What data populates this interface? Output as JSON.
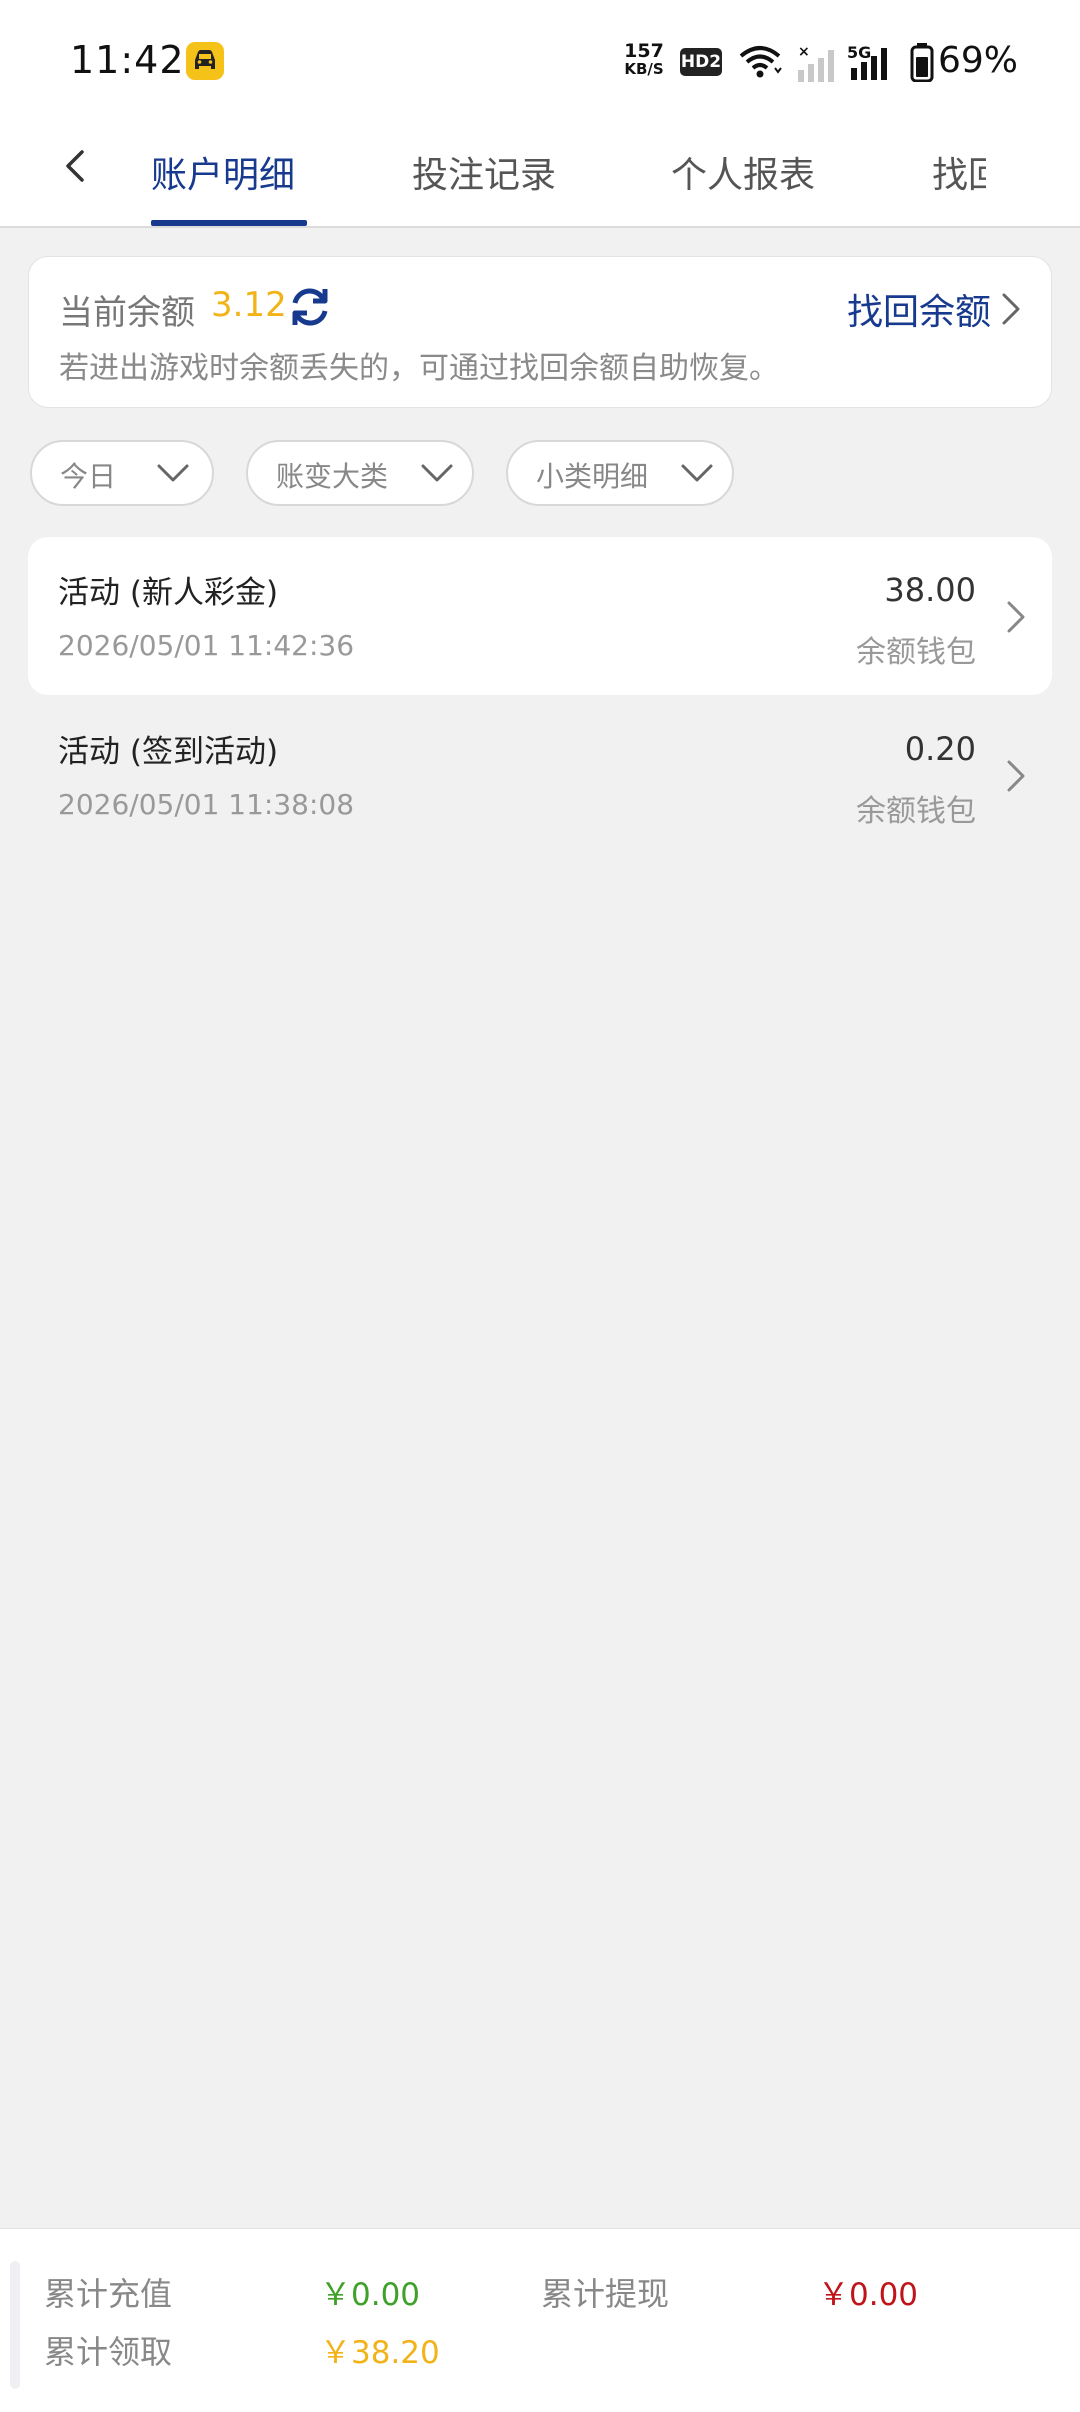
{
  "status_bar": {
    "time": "11:42",
    "net_speed_value": "157",
    "net_speed_unit": "KB/S",
    "hd_badge": "HD2",
    "signal_label": "5G",
    "battery": "69%",
    "app_icon": "car-icon"
  },
  "tabs": [
    {
      "label": "账户明细",
      "active": true
    },
    {
      "label": "投注记录",
      "active": false
    },
    {
      "label": "个人报表",
      "active": false
    },
    {
      "label": "找回",
      "active": false
    }
  ],
  "balance": {
    "label": "当前余额",
    "value": "3.12",
    "recover_label": "找回余额",
    "hint": "若进出游戏时余额丢失的，可通过找回余额自助恢复。"
  },
  "filters": [
    {
      "label": "今日"
    },
    {
      "label": "账变大类"
    },
    {
      "label": "小类明细"
    }
  ],
  "records": [
    {
      "title": "活动 (新人彩金)",
      "time": "2026/05/01 11:42:36",
      "amount": "38.00",
      "wallet": "余额钱包"
    },
    {
      "title": "活动 (签到活动)",
      "time": "2026/05/01 11:38:08",
      "amount": "0.20",
      "wallet": "余额钱包"
    }
  ],
  "summary": {
    "recharge_label": "累计充值",
    "recharge_value": "￥0.00",
    "withdraw_label": "累计提现",
    "withdraw_value": "￥0.00",
    "claimed_label": "累计领取",
    "claimed_value": "￥38.20"
  },
  "colors": {
    "accent": "#173a8f",
    "balance_yellow": "#f2b319",
    "recharge_green": "#3fa12a",
    "withdraw_red": "#c0141a",
    "claimed_yellow": "#f2b319"
  }
}
